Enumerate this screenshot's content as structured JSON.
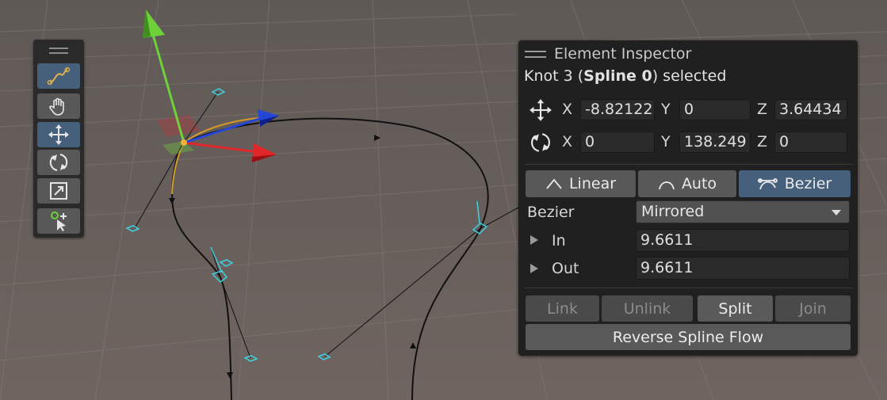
{
  "toolbar": {
    "tools": [
      {
        "name": "spline-tool-icon",
        "active": true
      },
      {
        "name": "hand-icon",
        "active": false
      },
      {
        "name": "move-icon",
        "active": true
      },
      {
        "name": "rotate-icon",
        "active": false
      },
      {
        "name": "scale-icon",
        "active": false
      },
      {
        "name": "add-knot-icon",
        "active": false
      }
    ]
  },
  "inspector": {
    "title": "Element Inspector",
    "selection": {
      "prefix": "Knot 3 (",
      "spline": "Spline 0",
      "suffix": ") selected"
    },
    "position": {
      "x_label": "X",
      "x": "-8.82122",
      "y_label": "Y",
      "y": "0",
      "z_label": "Z",
      "z": "3.64434"
    },
    "rotation": {
      "x_label": "X",
      "x": "0",
      "y_label": "Y",
      "y": "138.249",
      "z_label": "Z",
      "z": "0"
    },
    "modes": {
      "linear": "Linear",
      "auto": "Auto",
      "bezier": "Bezier",
      "active": "bezier"
    },
    "bezier": {
      "label": "Bezier",
      "value": "Mirrored"
    },
    "tangent_in": {
      "label": "In",
      "value": "9.6611"
    },
    "tangent_out": {
      "label": "Out",
      "value": "9.6611"
    },
    "actions": {
      "link": "Link",
      "unlink": "Unlink",
      "split": "Split",
      "join": "Join"
    },
    "reverse": "Reverse Spline Flow"
  },
  "colors": {
    "background": "#6b625e",
    "accent": "#46607c",
    "gizmo_y": "#6fd13a",
    "gizmo_x": "#e0262a",
    "gizmo_z": "#2447d8",
    "tangent_handle": "#3fd0e0"
  }
}
